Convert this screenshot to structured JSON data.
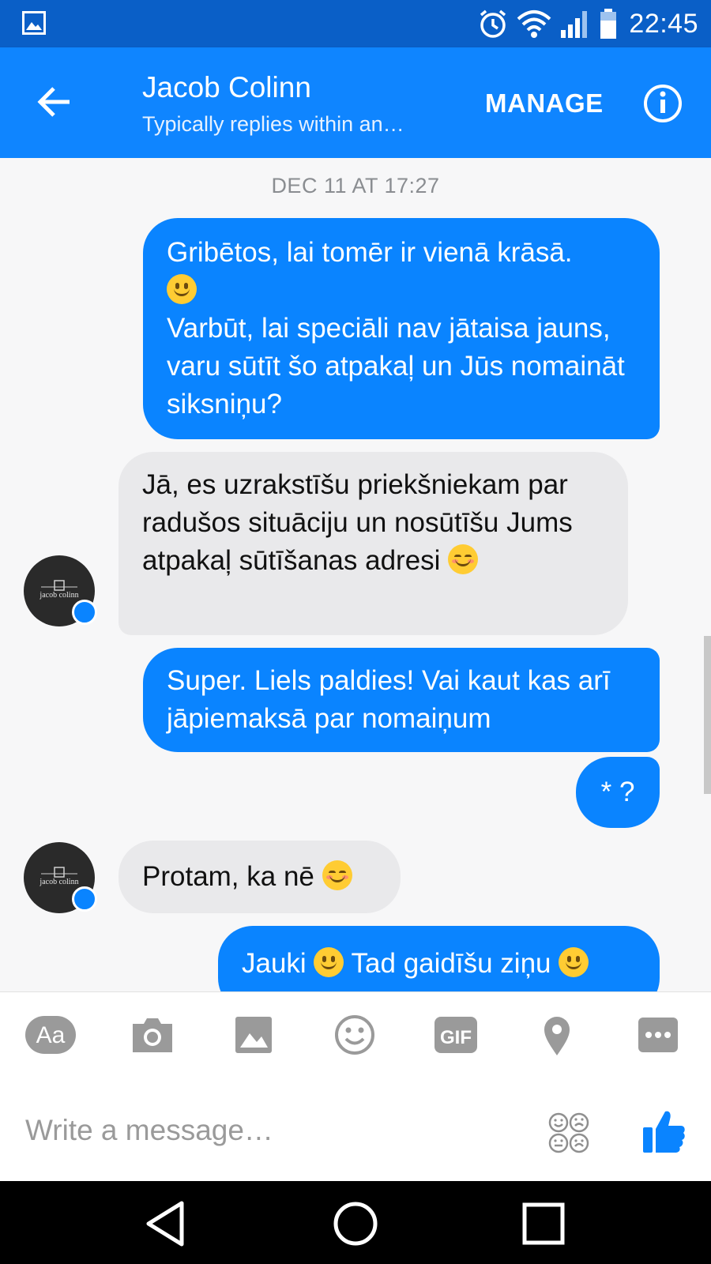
{
  "status_bar": {
    "time": "22:45",
    "icons": [
      "gallery-icon",
      "alarm-icon",
      "wifi-icon",
      "signal-icon",
      "battery-icon"
    ]
  },
  "header": {
    "contact_name": "Jacob Colinn",
    "subtitle": "Typically replies within an…",
    "manage_label": "MANAGE"
  },
  "conversation": {
    "date_stamp": "DEC 11 AT 17:27",
    "messages": [
      {
        "sender": "me",
        "lines": [
          "Gribētos, lai tomēr ir vienā krāsā.",
          "Varbūt, lai speciāli nav jātaisa jauns, varu sūtīt šo atpakaļ un Jūs nomaināt siksniņu?"
        ]
      },
      {
        "sender": "contact",
        "text": "Jā, es uzrakstīšu priekšniekam par radušos situāciju un nosūtīšu Jums atpakaļ sūtīšanas adresi"
      },
      {
        "sender": "me",
        "text": "Super. Liels paldies! Vai kaut kas arī jāpiemaksā par nomaiņum"
      },
      {
        "sender": "me",
        "text": "* ?"
      },
      {
        "sender": "contact",
        "text": "Protam, ka nē"
      },
      {
        "sender": "me",
        "parts": [
          "Jauki",
          "Tad gaidīšu ziņu"
        ]
      }
    ],
    "avatar_label": "jacob colinn"
  },
  "toolbar": {
    "text_label": "Aa",
    "gif_label": "GIF",
    "items": [
      "text-format-icon",
      "camera-icon",
      "image-icon",
      "emoji-icon",
      "gif-icon",
      "location-icon",
      "more-icon"
    ]
  },
  "composer": {
    "placeholder": "Write a message…"
  },
  "colors": {
    "header": "#0f85ff",
    "status_bar": "#0a5fc7",
    "outgoing": "#0a84ff",
    "incoming": "#e9e9eb"
  }
}
